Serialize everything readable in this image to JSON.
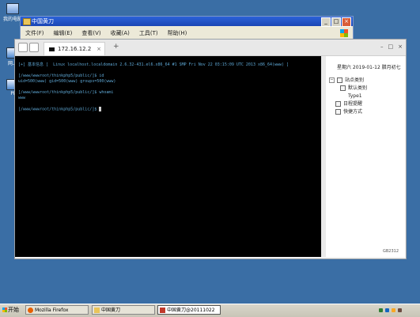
{
  "desktop": {
    "icons": [
      {
        "label": "我的电脑",
        "icon": "computer-icon"
      },
      {
        "label": "网上",
        "icon": "network-icon"
      },
      {
        "label": "Pi",
        "icon": "app-icon"
      }
    ]
  },
  "explorer": {
    "title": "中国黄刀",
    "menu": [
      "文件(F)",
      "编辑(E)",
      "查看(V)",
      "收藏(A)",
      "工具(T)",
      "帮助(H)"
    ]
  },
  "terminal_window": {
    "tab_label": "172.16.12.2",
    "new_tab": "+",
    "lines": [
      "[+] 基本信息 [  Linux localhost.localdomain 2.6.32-431.el6.x86_64 #1 SMP Fri Nov 22 03:15:09 UTC 2013 x86_64(www) ]",
      "",
      "[/www/wwwroot/thinkphp5/public/]$ id",
      "uid=500(www) gid=500(www) groups=500(www)",
      "",
      "[/www/wwwroot/thinkphp5/public/]$ whoami",
      "www",
      "",
      "[/www/wwwroot/thinkphp5/public/]$ "
    ]
  },
  "sidebar": {
    "date": "星期六 2019-01-12 腊月初七",
    "tree": [
      {
        "label": "站点类别",
        "level": 0,
        "toggle": "−"
      },
      {
        "label": "默认类别",
        "level": 1
      },
      {
        "label": "Type1",
        "level": 2
      },
      {
        "label": "日程提醒",
        "level": 0
      },
      {
        "label": "快捷方式",
        "level": 0
      }
    ],
    "corner_text": "GB2312"
  },
  "taskbar": {
    "start_label": "开始",
    "tasks": [
      {
        "label": "Mozilla Firefox",
        "color": "#e66000"
      },
      {
        "label": "中国黄刀",
        "color": "#e9c45a"
      },
      {
        "label": "中国黄刀@20111022",
        "color": "#c0392b"
      }
    ]
  }
}
